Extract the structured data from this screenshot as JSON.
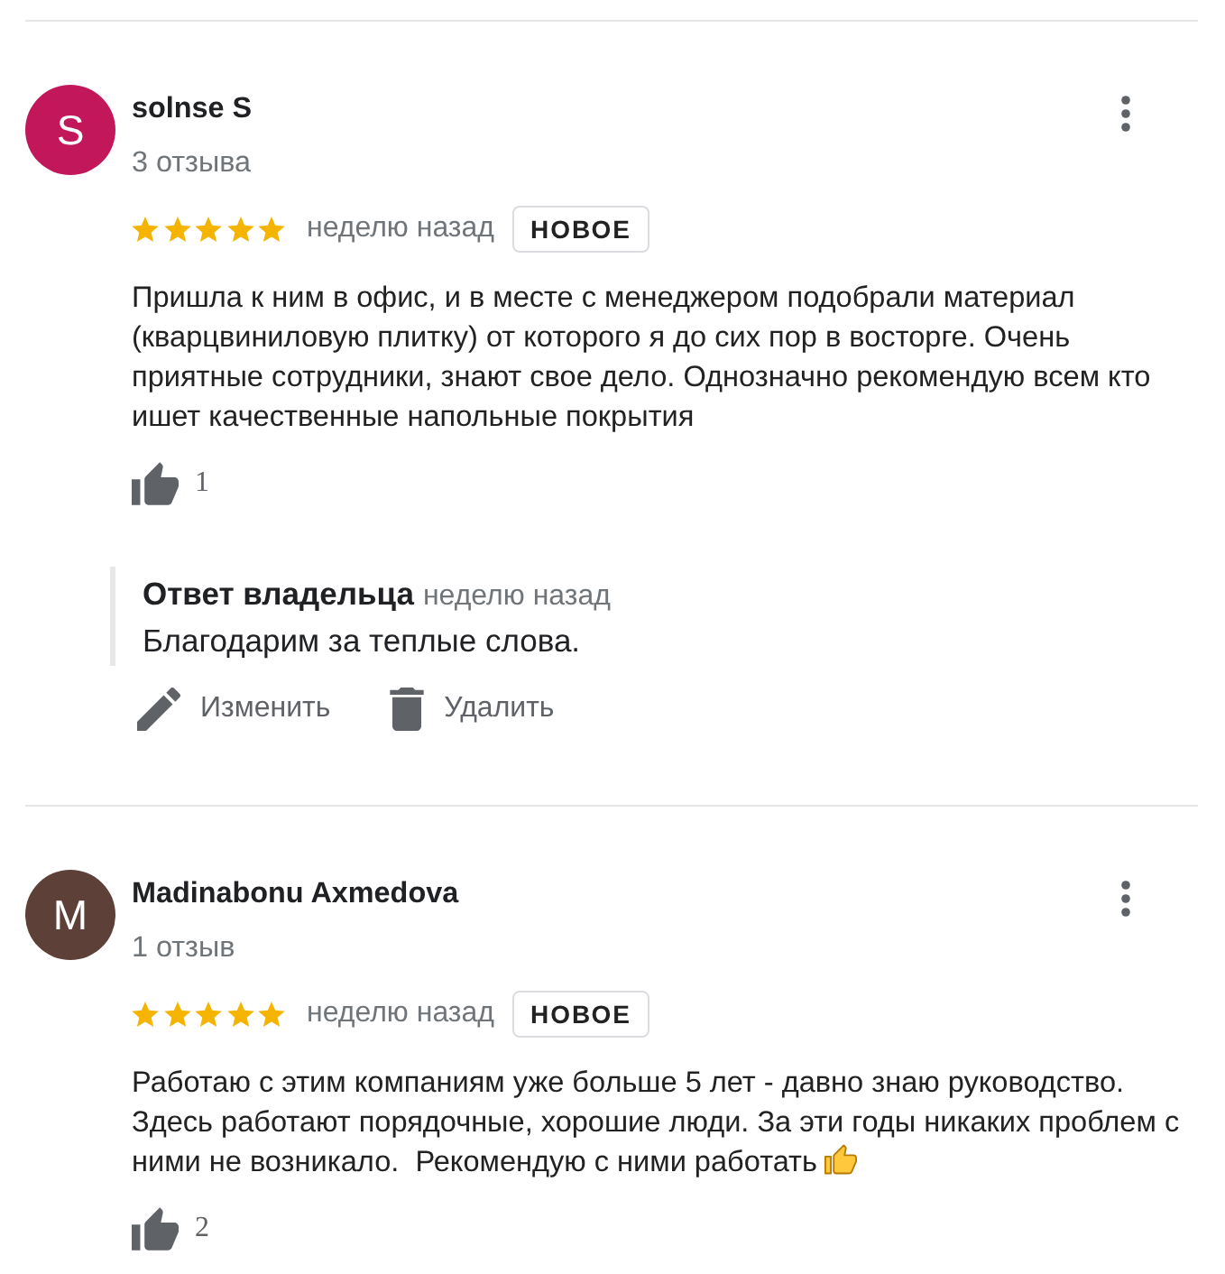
{
  "reviews": [
    {
      "avatar": {
        "letter": "S",
        "color": "#c2185b"
      },
      "author": "solnse S",
      "review_count": "3 отзыва",
      "stars": 5,
      "time": "неделю назад",
      "badge": "НОВОЕ",
      "text": "Пришла к ним в офис, и в месте с менеджером подобрали материал (кварцвиниловую плитку) от которого я до сих пор в восторге. Очень приятные сотрудники, знают свое дело. Однозначно рекомендую всем кто ишет качественные напольные покрытия",
      "emoji": false,
      "likes": "1",
      "owner_reply": {
        "label": "Ответ владельца",
        "time": "неделю назад",
        "text": "Благодарим за теплые слова."
      },
      "actions": [
        {
          "kind": "edit",
          "label": "Изменить"
        },
        {
          "kind": "delete",
          "label": "Удалить"
        }
      ]
    },
    {
      "avatar": {
        "letter": "M",
        "color": "#5d4037"
      },
      "author": "Madinabonu Axmedova",
      "review_count": "1 отзыв",
      "stars": 5,
      "time": "неделю назад",
      "badge": "НОВОЕ",
      "text": "Работаю с этим компаниям уже больше 5 лет - давно знаю руководство. Здесь работают порядочные, хорошие люди. За эти годы никаких проблем с ними не возникало.  Рекомендую с ними работать",
      "emoji": true,
      "likes": "2"
    }
  ]
}
